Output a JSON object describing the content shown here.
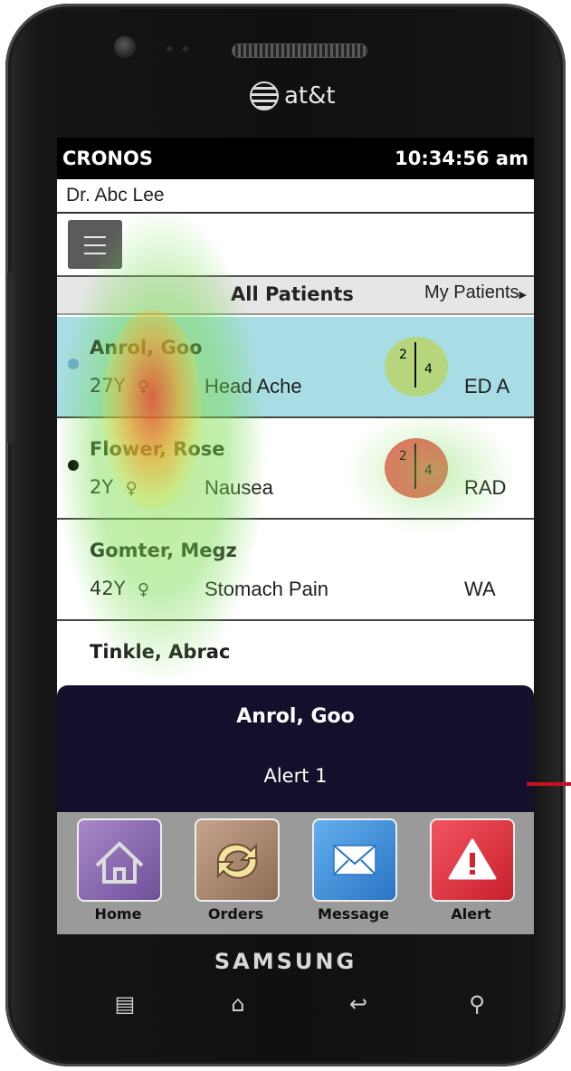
{
  "device": {
    "carrier": "at&t",
    "brand": "SAMSUNG"
  },
  "status_bar": {
    "app_name": "CRONOS",
    "time": "10:34:56 am"
  },
  "header": {
    "doctor": "Dr. Abc Lee"
  },
  "tabs": {
    "all": "All Patients",
    "my": "My Patients"
  },
  "patients": [
    {
      "name": "Anrol, Goo",
      "age": "27Y",
      "sex": "♀",
      "complaint": "Head Ache",
      "location": "ED A",
      "score_top": "2",
      "score_bottom": "4",
      "score_color": "#b9d36a",
      "dot_color": "#6aa7d6",
      "highlight": true
    },
    {
      "name": "Flower, Rose",
      "age": "2Y",
      "sex": "♀",
      "complaint": "Nausea",
      "location": "RAD",
      "score_top": "2",
      "score_bottom": "4",
      "score_color": "#ec4646",
      "dot_color": "#000000",
      "highlight": false
    },
    {
      "name": "Gomter, Megz",
      "age": "42Y",
      "sex": "♀",
      "complaint": "Stomach Pain",
      "location": "WA"
    },
    {
      "name": "Tinkle, Abrac"
    }
  ],
  "alert_panel": {
    "patient": "Anrol, Goo",
    "message": "Alert 1"
  },
  "nav": [
    {
      "label": "Home",
      "icon": "home-icon",
      "color": "#8c6bb1"
    },
    {
      "label": "Orders",
      "icon": "orders-icon",
      "color": "#b08c73"
    },
    {
      "label": "Message",
      "icon": "message-icon",
      "color": "#3e8fd8"
    },
    {
      "label": "Alert",
      "icon": "alert-icon",
      "color": "#e0353f"
    }
  ],
  "colors": {
    "highlight_row": "#a9dde6",
    "alert_panel": "#12102a",
    "nav_bar": "#9a9a9a",
    "marker": "#c8101e"
  }
}
